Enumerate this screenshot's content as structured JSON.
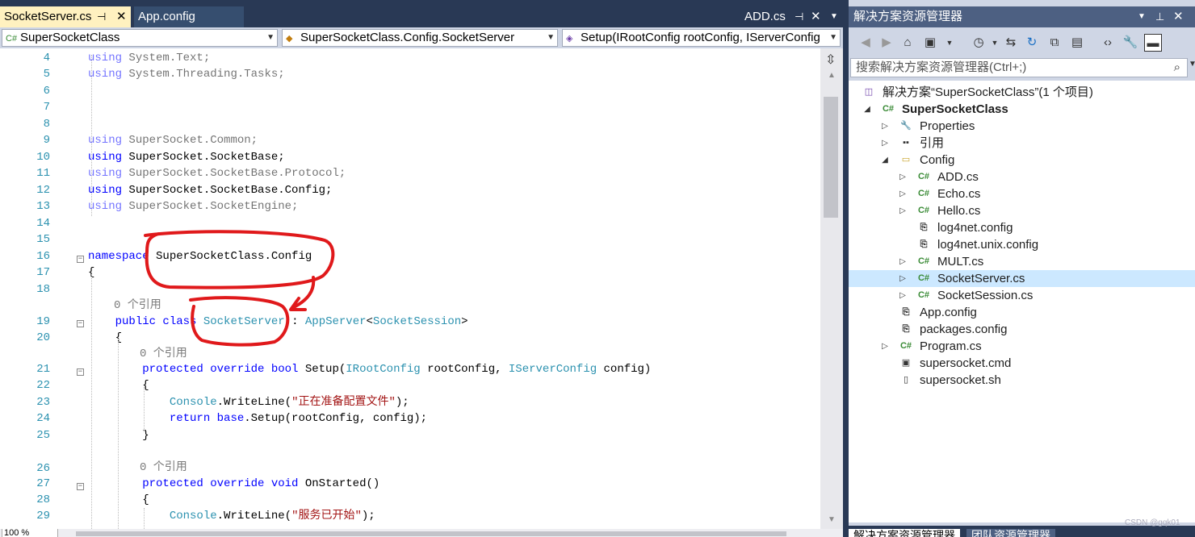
{
  "editor": {
    "tabs": {
      "active": "SocketServer.cs",
      "second": "App.config",
      "right": "ADD.cs"
    },
    "nav": {
      "project": "SuperSocketClass",
      "class": "SuperSocketClass.Config.SocketServer",
      "member": "Setup(IRootConfig rootConfig, IServerConfig"
    },
    "lines": [
      {
        "n": "4",
        "tokens": [
          {
            "k": "kw",
            "t": "using"
          },
          {
            "k": "",
            "t": " System.Text;"
          }
        ],
        "dim": true
      },
      {
        "n": "5",
        "tokens": [
          {
            "k": "kw",
            "t": "using"
          },
          {
            "k": "",
            "t": " System.Threading.Tasks;"
          }
        ],
        "dim": true
      },
      {
        "n": "6",
        "tokens": []
      },
      {
        "n": "7",
        "tokens": []
      },
      {
        "n": "8",
        "tokens": []
      },
      {
        "n": "9",
        "tokens": [
          {
            "k": "kw",
            "t": "using"
          },
          {
            "k": "",
            "t": " SuperSocket.Common;"
          }
        ],
        "dim": true
      },
      {
        "n": "10",
        "tokens": [
          {
            "k": "kw",
            "t": "using"
          },
          {
            "k": "",
            "t": " SuperSocket.SocketBase;"
          }
        ]
      },
      {
        "n": "11",
        "tokens": [
          {
            "k": "kw",
            "t": "using"
          },
          {
            "k": "",
            "t": " SuperSocket.SocketBase.Protocol;"
          }
        ],
        "dim": true
      },
      {
        "n": "12",
        "tokens": [
          {
            "k": "kw",
            "t": "using"
          },
          {
            "k": "",
            "t": " SuperSocket.SocketBase.Config;"
          }
        ]
      },
      {
        "n": "13",
        "tokens": [
          {
            "k": "kw",
            "t": "using"
          },
          {
            "k": "",
            "t": " SuperSocket.SocketEngine;"
          }
        ],
        "dim": true
      },
      {
        "n": "14",
        "tokens": []
      },
      {
        "n": "15",
        "tokens": []
      },
      {
        "n": "16",
        "tokens": [
          {
            "k": "kw",
            "t": "namespace"
          },
          {
            "k": "",
            "t": " SuperSocketClass.Config"
          }
        ]
      },
      {
        "n": "17",
        "tokens": [
          {
            "k": "",
            "t": "{"
          }
        ]
      },
      {
        "n": "18",
        "tokens": []
      },
      {
        "n": "19",
        "tokens": [
          {
            "k": "",
            "t": "    "
          },
          {
            "k": "kw",
            "t": "public class"
          },
          {
            "k": "",
            "t": " "
          },
          {
            "k": "ty",
            "t": "SocketServer"
          },
          {
            "k": "",
            "t": " : "
          },
          {
            "k": "ty",
            "t": "AppServer"
          },
          {
            "k": "",
            "t": "<"
          },
          {
            "k": "ty",
            "t": "SocketSession"
          },
          {
            "k": "",
            "t": ">"
          }
        ]
      },
      {
        "n": "20",
        "tokens": [
          {
            "k": "",
            "t": "    {"
          }
        ]
      },
      {
        "n": "21",
        "tokens": [
          {
            "k": "",
            "t": "        "
          },
          {
            "k": "kw",
            "t": "protected override bool"
          },
          {
            "k": "",
            "t": " Setup("
          },
          {
            "k": "ty",
            "t": "IRootConfig"
          },
          {
            "k": "",
            "t": " rootConfig, "
          },
          {
            "k": "ty",
            "t": "IServerConfig"
          },
          {
            "k": "",
            "t": " config)"
          }
        ]
      },
      {
        "n": "22",
        "tokens": [
          {
            "k": "",
            "t": "        {"
          }
        ]
      },
      {
        "n": "23",
        "tokens": [
          {
            "k": "",
            "t": "            "
          },
          {
            "k": "ty",
            "t": "Console"
          },
          {
            "k": "",
            "t": ".WriteLine("
          },
          {
            "k": "str",
            "t": "\"正在准备配置文件\""
          },
          {
            "k": "",
            "t": ");"
          }
        ]
      },
      {
        "n": "24",
        "tokens": [
          {
            "k": "",
            "t": "            "
          },
          {
            "k": "kw",
            "t": "return base"
          },
          {
            "k": "",
            "t": ".Setup(rootConfig, config);"
          }
        ]
      },
      {
        "n": "25",
        "tokens": [
          {
            "k": "",
            "t": "        }"
          }
        ]
      },
      {
        "n": "26",
        "tokens": []
      },
      {
        "n": "27",
        "tokens": [
          {
            "k": "",
            "t": "        "
          },
          {
            "k": "kw",
            "t": "protected override void"
          },
          {
            "k": "",
            "t": " OnStarted()"
          }
        ]
      },
      {
        "n": "28",
        "tokens": [
          {
            "k": "",
            "t": "        {"
          }
        ]
      },
      {
        "n": "29",
        "tokens": [
          {
            "k": "",
            "t": "            "
          },
          {
            "k": "ty",
            "t": "Console"
          },
          {
            "k": "",
            "t": ".WriteLine("
          },
          {
            "k": "str",
            "t": "\"服务已开始\""
          },
          {
            "k": "",
            "t": ");"
          }
        ]
      }
    ],
    "codelens": "0 个引用",
    "zoom": "100 %"
  },
  "explorer": {
    "title": "解决方案资源管理器",
    "search_placeholder": "搜索解决方案资源管理器(Ctrl+;)",
    "items": [
      {
        "label": "解决方案“SuperSocketClass”(1 个项目)",
        "icon": "solution-icon",
        "depth": 0,
        "expander": ""
      },
      {
        "label": "SuperSocketClass",
        "icon": "csharp-project-icon",
        "depth": 0,
        "expander": "open",
        "bold": true
      },
      {
        "label": "Properties",
        "icon": "wrench-icon",
        "depth": 1,
        "expander": "closed"
      },
      {
        "label": "引用",
        "icon": "references-icon",
        "depth": 1,
        "expander": "closed"
      },
      {
        "label": "Config",
        "icon": "folder-icon",
        "depth": 1,
        "expander": "open"
      },
      {
        "label": "ADD.cs",
        "icon": "csharp-file-icon",
        "depth": 2,
        "expander": "closed"
      },
      {
        "label": "Echo.cs",
        "icon": "csharp-file-icon",
        "depth": 2,
        "expander": "closed"
      },
      {
        "label": "Hello.cs",
        "icon": "csharp-file-icon",
        "depth": 2,
        "expander": "closed"
      },
      {
        "label": "log4net.config",
        "icon": "config-file-icon",
        "depth": 2,
        "expander": ""
      },
      {
        "label": "log4net.unix.config",
        "icon": "config-file-icon",
        "depth": 2,
        "expander": ""
      },
      {
        "label": "MULT.cs",
        "icon": "csharp-file-icon",
        "depth": 2,
        "expander": "closed"
      },
      {
        "label": "SocketServer.cs",
        "icon": "csharp-file-icon",
        "depth": 2,
        "expander": "closed",
        "selected": true
      },
      {
        "label": "SocketSession.cs",
        "icon": "csharp-file-icon",
        "depth": 2,
        "expander": "closed"
      },
      {
        "label": "App.config",
        "icon": "config-file-icon",
        "depth": 1,
        "expander": ""
      },
      {
        "label": "packages.config",
        "icon": "config-file-icon",
        "depth": 1,
        "expander": ""
      },
      {
        "label": "Program.cs",
        "icon": "csharp-file-icon",
        "depth": 1,
        "expander": "closed"
      },
      {
        "label": "supersocket.cmd",
        "icon": "cmd-file-icon",
        "depth": 1,
        "expander": ""
      },
      {
        "label": "supersocket.sh",
        "icon": "file-icon",
        "depth": 1,
        "expander": ""
      }
    ],
    "bottom_tabs": {
      "solution": "解决方案资源管理器",
      "team": "团队资源管理器"
    },
    "watermark": "CSDN @gqk01"
  },
  "colors": {
    "annotation": "#e0191b",
    "keyword": "#0000ff",
    "type": "#2b91af",
    "string": "#a31515"
  }
}
